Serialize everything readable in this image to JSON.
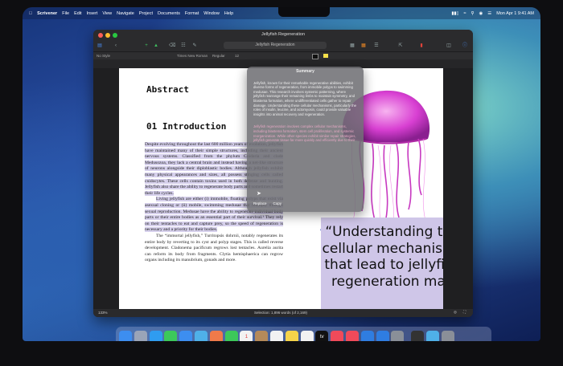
{
  "menubar": {
    "app": "Scrivener",
    "items": [
      "File",
      "Edit",
      "Insert",
      "View",
      "Navigate",
      "Project",
      "Documents",
      "Format",
      "Window",
      "Help"
    ],
    "clock": "Mon Apr 1  9:41 AM"
  },
  "window": {
    "title": "Jellyfish Regeneration",
    "search_value": "Jellyfish Regeneration",
    "style": "No Style",
    "font": "Times New Roman",
    "weight": "Regular",
    "size": "12"
  },
  "document": {
    "abstract_heading": "Abstract",
    "intro_heading": "01 Introduction",
    "para1": "Despite evolving throughout the last 600 million years of evolution, jellyfish have maintained many of their simple structures, including their ancient nervous systems. Classified from the phylum Cnidaria and clade Medusozoa, they lack a central brain and instead having a net-like structure of neurons alongside their diploblastic bodies. Although jellyfish exhibit many physical appearances and sizes, all possess stinging cells called cnidocytes. These cells contain toxins used in both defense and hunting. Jellyfish also share the ability to regenerate body parts and sometimes restart their life cycles.",
    "para2": "Living jellyfish are either (i) immobile, floating polyps that exist via asexual cloning or (ii) mobile, swimming medusae that multiply through sexual reproduction. Medusae have the ability to regenerate individual body parts or their entire bodies as an essential part of their survival.¹ They rely on their tentacles to eat and capture prey, so the speed of regeneration is necessary and a priority for their bodies.",
    "para3": "The “immortal jellyfish,” Turritopsis dohrnii, notably regenerates its entire body by reverting to its cyst and polyp stages. This is called reverse development. Cladonema pacificum regrows lost tentacles. Aurelia aurita can reform its body from fragments. Clytia hemisphaerica can regrow organs including its manubrium, gonads and more.",
    "quote": "“Understanding the cellular mechanisms that lead to jellyfish regeneration may",
    "pilcrow": "¶"
  },
  "summary": {
    "title": "Summary",
    "para1": "Jellyfish, known for their remarkable regenerative abilities, exhibit diverse forms of regeneration, from immobile polyps to swimming medusae. This research involves systemic patterning, where jellyfish rearrange their remaining limbs to maintain symmetry, and blastema formation, where undifferentiated cells gather to repair damage. Understanding these cellular mechanisms, particularly the roles of insulin, leucine, and actomyosin, could provide valuable insights into animal recovery and regeneration.",
    "para2": "Jellyfish regeneration involves complex cellular mechanisms, including blastema formation, stem cell proliferation, and systemic reorganization. While other species exhibit similar repair strategies, jellyfish generate tissue far more quickly and efficiently due to their",
    "replace": "Replace",
    "copy": "Copy"
  },
  "status": {
    "zoom": "133%",
    "word_count": "Selection: 1,896 words (of 2,169)"
  },
  "dock_icons": [
    "finder-icon",
    "launchpad-icon",
    "safari-icon",
    "messages-icon",
    "mail-icon",
    "maps-icon",
    "photos-icon",
    "facetime-icon",
    "calendar-icon",
    "contacts-icon",
    "reminders-icon",
    "notes-icon",
    "freeform-icon",
    "apple-tv-icon",
    "music-icon",
    "news-icon",
    "keynote-icon",
    "app-store-icon",
    "system-settings-icon",
    "scrivener-icon",
    "downloads-icon",
    "trash-icon"
  ],
  "dock_glyphs": {
    "calendar-icon": "1",
    "apple-tv-icon": "tv"
  },
  "colors": {
    "accent": "#2f7de1",
    "highlight": "#d6d0ec",
    "quote_bg": "#cfc6e8",
    "jellyfish": "#d83fd2"
  }
}
